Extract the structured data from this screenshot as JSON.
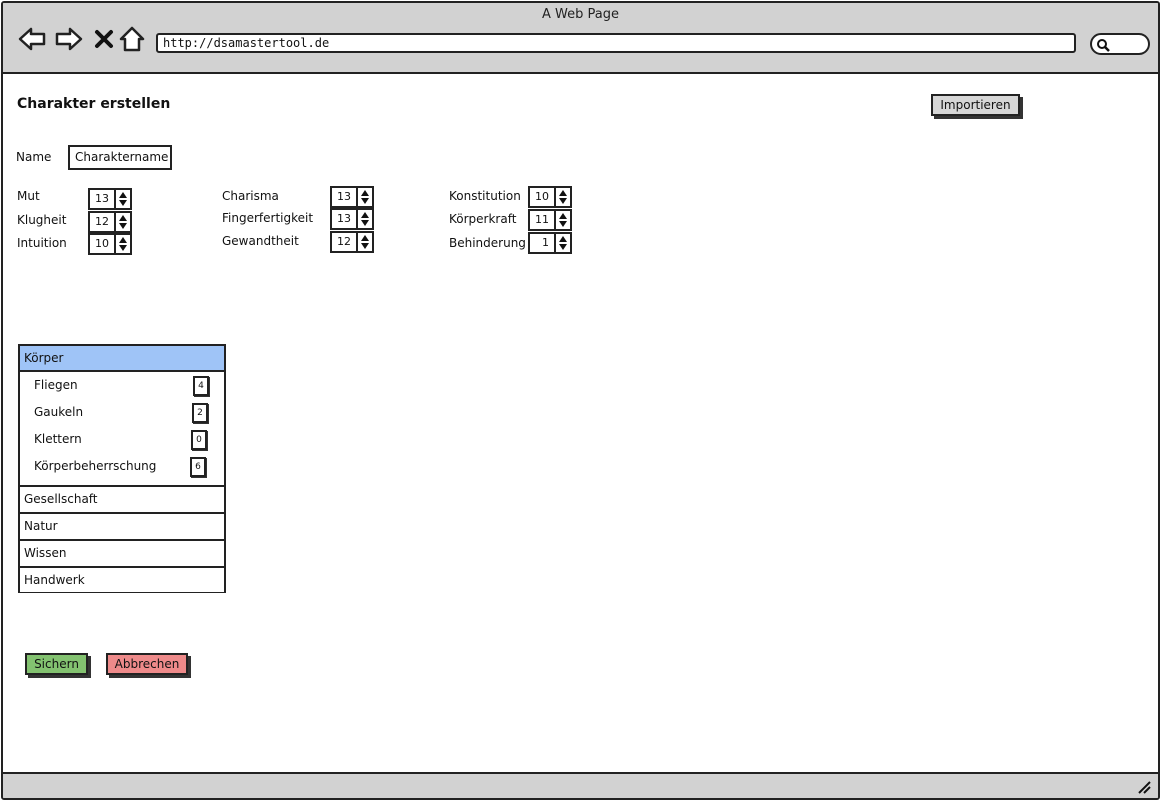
{
  "window": {
    "title": "A Web Page"
  },
  "browser": {
    "url": "http://dsamastertool.de"
  },
  "page": {
    "title": "Charakter erstellen",
    "import_label": "Importieren"
  },
  "name_field": {
    "label": "Name",
    "value": "Charaktername"
  },
  "attributes": {
    "mut": {
      "label": "Mut",
      "value": "13"
    },
    "klugheit": {
      "label": "Klugheit",
      "value": "12"
    },
    "intuition": {
      "label": "Intuition",
      "value": "10"
    },
    "charisma": {
      "label": "Charisma",
      "value": "13"
    },
    "fingerfertigkeit": {
      "label": "Fingerfertigkeit",
      "value": "13"
    },
    "gewandtheit": {
      "label": "Gewandtheit",
      "value": "12"
    },
    "konstitution": {
      "label": "Konstitution",
      "value": "10"
    },
    "koerperkraft": {
      "label": "Körperkraft",
      "value": "11"
    },
    "behinderung": {
      "label": "Behinderung",
      "value": "1"
    }
  },
  "skills": {
    "open_group": "Körper",
    "items": [
      {
        "label": "Fliegen",
        "value": "4"
      },
      {
        "label": "Gaukeln",
        "value": "2"
      },
      {
        "label": "Klettern",
        "value": "0"
      },
      {
        "label": "Körperbeherrschung",
        "value": "6"
      }
    ],
    "groups": [
      "Gesellschaft",
      "Natur",
      "Wissen",
      "Handwerk"
    ]
  },
  "actions": {
    "save_label": "Sichern",
    "cancel_label": "Abbrechen"
  },
  "colors": {
    "active_group": "#9fc4f7",
    "save_button": "#83c270",
    "cancel_button": "#ee8a8a",
    "chrome": "#d2d2d2"
  }
}
